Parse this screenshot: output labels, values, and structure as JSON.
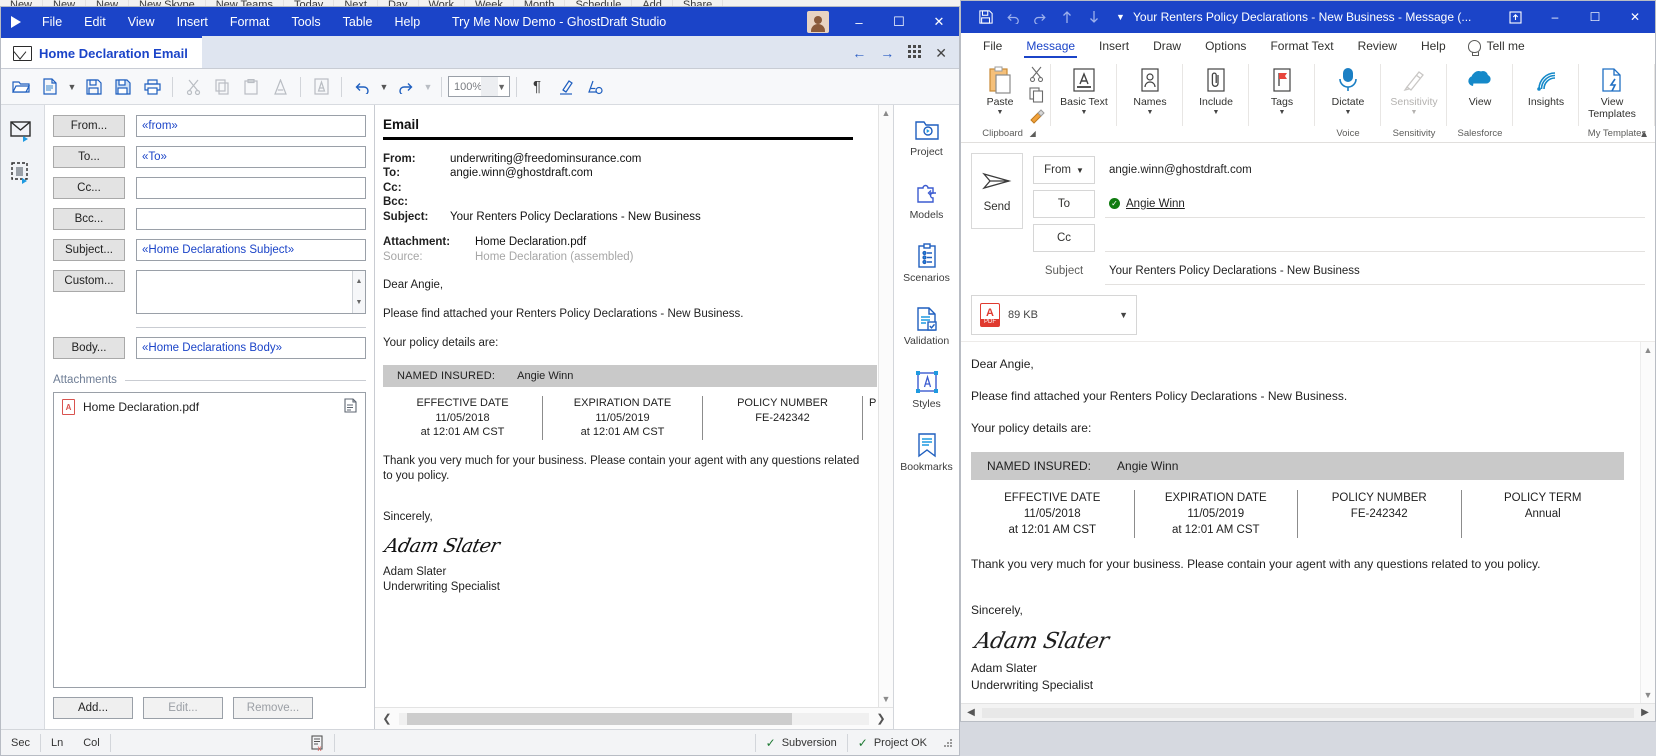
{
  "background_ribbon": {
    "items": [
      "New",
      "New",
      "New",
      "New Skype",
      "New Teams",
      "Today",
      "Next",
      "Day",
      "Work",
      "Week",
      "Month",
      "Schedule",
      "Add",
      "Share"
    ]
  },
  "ghostdraft": {
    "titlebar": {
      "title": "Try Me Now Demo - GhostDraft Studio",
      "menus": [
        "File",
        "Edit",
        "View",
        "Insert",
        "Format",
        "Tools",
        "Table",
        "Help"
      ],
      "window_buttons": {
        "minimize": "–",
        "maximize": "☐",
        "close": "✕"
      },
      "avatar_name": "avatar"
    },
    "tab": {
      "label": "Home Declaration Email",
      "nav_back": "←",
      "nav_forward": "→",
      "grid": "grid-icon",
      "close": "✕"
    },
    "toolbar": {
      "zoom_value": "100%",
      "buttons": [
        "open",
        "new-document",
        "save",
        "save-all",
        "print",
        "cut",
        "copy",
        "paste",
        "format-painter",
        "find-replace",
        "undo",
        "redo",
        "pilcrow",
        "highlight",
        "clear-formatting"
      ]
    },
    "rail": [
      "email-compose-icon",
      "document-stamp-icon"
    ],
    "form": {
      "rows": [
        {
          "label": "From...",
          "value": "«from»"
        },
        {
          "label": "To...",
          "value": "«To»"
        },
        {
          "label": "Cc...",
          "value": ""
        },
        {
          "label": "Bcc...",
          "value": ""
        },
        {
          "label": "Subject...",
          "value": "«Home Declarations Subject»"
        },
        {
          "label": "Custom...",
          "value": ""
        },
        {
          "label": "Body...",
          "value": "«Home Declarations Body»"
        }
      ],
      "attachments_section": "Attachments",
      "attachment_file": "Home Declaration.pdf",
      "buttons": {
        "add": "Add...",
        "edit": "Edit...",
        "remove": "Remove..."
      }
    },
    "preview": {
      "heading": "Email",
      "from_label": "From:",
      "from_value": "underwriting@freedominsurance.com",
      "to_label": "To:",
      "to_value": "angie.winn@ghostdraft.com",
      "cc_label": "Cc:",
      "cc_value": "",
      "bcc_label": "Bcc:",
      "bcc_value": "",
      "subject_label": "Subject:",
      "subject_value": "Your Renters Policy Declarations - New Business",
      "attachment_label": "Attachment:",
      "attachment_value": "Home Declaration.pdf",
      "source_label": "Source:",
      "source_value": "Home Declaration (assembled)",
      "salutation": "Dear Angie,",
      "para1": "Please find attached your Renters Policy Declarations - New Business.",
      "para2": "Your policy details are:",
      "named_insured_label": "NAMED INSURED:",
      "named_insured_value": "Angie Winn",
      "table": [
        {
          "header": "EFFECTIVE DATE",
          "line1": "11/05/2018",
          "line2": "at 12:01 AM CST"
        },
        {
          "header": "EXPIRATION DATE",
          "line1": "11/05/2019",
          "line2": "at 12:01 AM CST"
        },
        {
          "header": "POLICY NUMBER",
          "line1": "FE-242342",
          "line2": ""
        },
        {
          "header": "P",
          "line1": "",
          "line2": ""
        }
      ],
      "closing": "Thank you very much for your business.  Please contain your agent with any questions related to you policy.",
      "signoff": "Sincerely,",
      "signature_script": "Adam Slater",
      "signer_name": "Adam Slater",
      "signer_title": "Underwriting Specialist"
    },
    "nav": [
      {
        "label": "Project",
        "icon": "project-folder-icon"
      },
      {
        "label": "Models",
        "icon": "models-puzzle-icon"
      },
      {
        "label": "Scenarios",
        "icon": "scenarios-clipboard-icon"
      },
      {
        "label": "Validation",
        "icon": "validation-document-icon"
      },
      {
        "label": "Styles",
        "icon": "styles-icon"
      },
      {
        "label": "Bookmarks",
        "icon": "bookmark-icon"
      }
    ],
    "status": {
      "sec": "Sec",
      "ln": "Ln",
      "col": "Col",
      "doc_icon": "document-error-icon",
      "subversion": "Subversion",
      "project_ok": "Project OK",
      "check": "✓"
    }
  },
  "outlook": {
    "titlebar": {
      "title": "Your Renters Policy Declarations - New Business  -  Message (...",
      "qat": [
        "save-icon",
        "undo-icon",
        "redo-icon",
        "up-icon",
        "down-icon",
        "customize-qat-icon"
      ],
      "restore_down": "⬒",
      "minimize": "–",
      "maximize": "☐",
      "close": "✕"
    },
    "tabs": [
      "File",
      "Message",
      "Insert",
      "Draw",
      "Options",
      "Format Text",
      "Review",
      "Help"
    ],
    "active_tab": "Message",
    "tell_me": "Tell me",
    "ribbon_groups": [
      {
        "name": "Clipboard",
        "buttons": [
          {
            "label": "Paste",
            "icon": "paste-icon",
            "caret": true,
            "disabled": false
          },
          {
            "label": "",
            "icon": "cut-icon",
            "caret": false,
            "disabled": false
          },
          {
            "label": "",
            "icon": "copy-icon",
            "caret": false,
            "disabled": false
          },
          {
            "label": "",
            "icon": "format-painter-icon",
            "caret": false,
            "disabled": false
          }
        ]
      },
      {
        "name": "",
        "buttons": [
          {
            "label": "Basic Text",
            "icon": "basic-text-icon",
            "caret": true,
            "disabled": false
          }
        ]
      },
      {
        "name": "",
        "buttons": [
          {
            "label": "Names",
            "icon": "names-icon",
            "caret": true,
            "disabled": false
          }
        ]
      },
      {
        "name": "",
        "buttons": [
          {
            "label": "Include",
            "icon": "include-paperclip-icon",
            "caret": true,
            "disabled": false
          }
        ]
      },
      {
        "name": "",
        "buttons": [
          {
            "label": "Tags",
            "icon": "tags-flag-icon",
            "caret": true,
            "disabled": false
          }
        ]
      },
      {
        "name": "Voice",
        "buttons": [
          {
            "label": "Dictate",
            "icon": "dictate-mic-icon",
            "caret": true,
            "disabled": false
          }
        ]
      },
      {
        "name": "Sensitivity",
        "buttons": [
          {
            "label": "Sensitivity",
            "icon": "sensitivity-icon",
            "caret": true,
            "disabled": true
          }
        ]
      },
      {
        "name": "Salesforce",
        "buttons": [
          {
            "label": "View",
            "icon": "salesforce-cloud-icon",
            "caret": false,
            "disabled": false
          }
        ]
      },
      {
        "name": "",
        "buttons": [
          {
            "label": "Insights",
            "icon": "insights-icon",
            "caret": false,
            "disabled": false
          }
        ]
      },
      {
        "name": "My Templates",
        "buttons": [
          {
            "label": "View Templates",
            "icon": "view-templates-icon",
            "caret": false,
            "disabled": false
          }
        ]
      }
    ],
    "compose": {
      "send_label": "Send",
      "from_label": "From",
      "from_value": "angie.winn@ghostdraft.com",
      "to_label": "To",
      "to_value": "Angie Winn",
      "cc_label": "Cc",
      "cc_value": "",
      "subject_label": "Subject",
      "subject_value": "Your Renters Policy Declarations - New Business",
      "attachment_size": "89 KB"
    },
    "body": {
      "salutation": "Dear Angie,",
      "para1": "Please find attached your Renters Policy Declarations - New Business.",
      "para2": "Your policy details are:",
      "named_insured_label": "NAMED INSURED:",
      "named_insured_value": "Angie Winn",
      "table": [
        {
          "header": "EFFECTIVE DATE",
          "line1": "11/05/2018",
          "line2": "at 12:01 AM CST"
        },
        {
          "header": "EXPIRATION DATE",
          "line1": "11/05/2019",
          "line2": "at 12:01 AM CST"
        },
        {
          "header": "POLICY NUMBER",
          "line1": "FE-242342",
          "line2": ""
        },
        {
          "header": "POLICY TERM",
          "line1": "Annual",
          "line2": ""
        }
      ],
      "closing": "Thank you very much for your business.  Please contain your agent with any questions related to you policy.",
      "signoff": "Sincerely,",
      "signature_script": "Adam Slater",
      "signer_name": "Adam Slater",
      "signer_title": "Underwriting Specialist"
    }
  }
}
